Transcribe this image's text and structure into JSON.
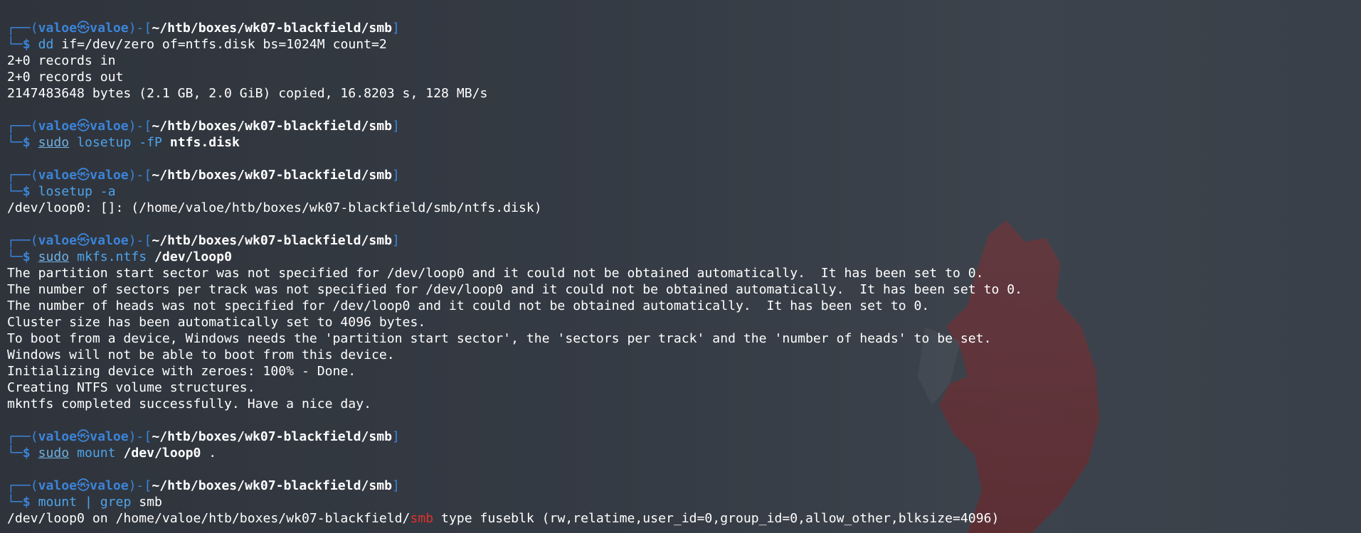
{
  "theme": {
    "background": "#353b44",
    "prompt_color": "#3b84d9",
    "command_color": "#4fa3e8",
    "highlight_color": "#e0302b"
  },
  "prompt": {
    "frame_top": "┌──",
    "open_paren": "(",
    "user": "valoe",
    "at_symbol": "㉿",
    "host": "valoe",
    "close_paren": ")",
    "sep": "-[",
    "cwd": "~/htb/boxes/wk07-blackfield/smb",
    "close_bracket": "]",
    "frame_bottom": "└─",
    "dollar": "$"
  },
  "commands": [
    {
      "cmd": "dd",
      "args": " if=/dev/zero of=ntfs.disk bs=1024M count=2",
      "output": [
        "2+0 records in",
        "2+0 records out",
        "2147483648 bytes (2.1 GB, 2.0 GiB) copied, 16.8203 s, 128 MB/s"
      ]
    },
    {
      "sudo": "sudo",
      "cmd": "losetup",
      "opt": " -fP",
      "argbold": " ntfs.disk",
      "output": []
    },
    {
      "cmd": "losetup",
      "opt": " -a",
      "output": [
        "/dev/loop0: []: (/home/valoe/htb/boxes/wk07-blackfield/smb/ntfs.disk)"
      ]
    },
    {
      "sudo": "sudo",
      "cmd": "mkfs.ntfs",
      "argbold": " /dev/loop0",
      "output": [
        "The partition start sector was not specified for /dev/loop0 and it could not be obtained automatically.  It has been set to 0.",
        "The number of sectors per track was not specified for /dev/loop0 and it could not be obtained automatically.  It has been set to 0.",
        "The number of heads was not specified for /dev/loop0 and it could not be obtained automatically.  It has been set to 0.",
        "Cluster size has been automatically set to 4096 bytes.",
        "To boot from a device, Windows needs the 'partition start sector', the 'sectors per track' and the 'number of heads' to be set.",
        "Windows will not be able to boot from this device.",
        "Initializing device with zeroes: 100% - Done.",
        "Creating NTFS volume structures.",
        "mkntfs completed successfully. Have a nice day."
      ]
    },
    {
      "sudo": "sudo",
      "cmd": "mount",
      "argbold": " /dev/loop0",
      "arg": " .",
      "output": []
    },
    {
      "cmd": "mount",
      "pipe": " | ",
      "cmd2": "grep",
      "arg": " smb",
      "output_last": {
        "before": "/dev/loop0 on /home/valoe/htb/boxes/wk07-blackfield/",
        "match": "smb",
        "after": " type fuseblk (rw,relatime,user_id=0,group_id=0,allow_other,blksize=4096)"
      }
    }
  ]
}
